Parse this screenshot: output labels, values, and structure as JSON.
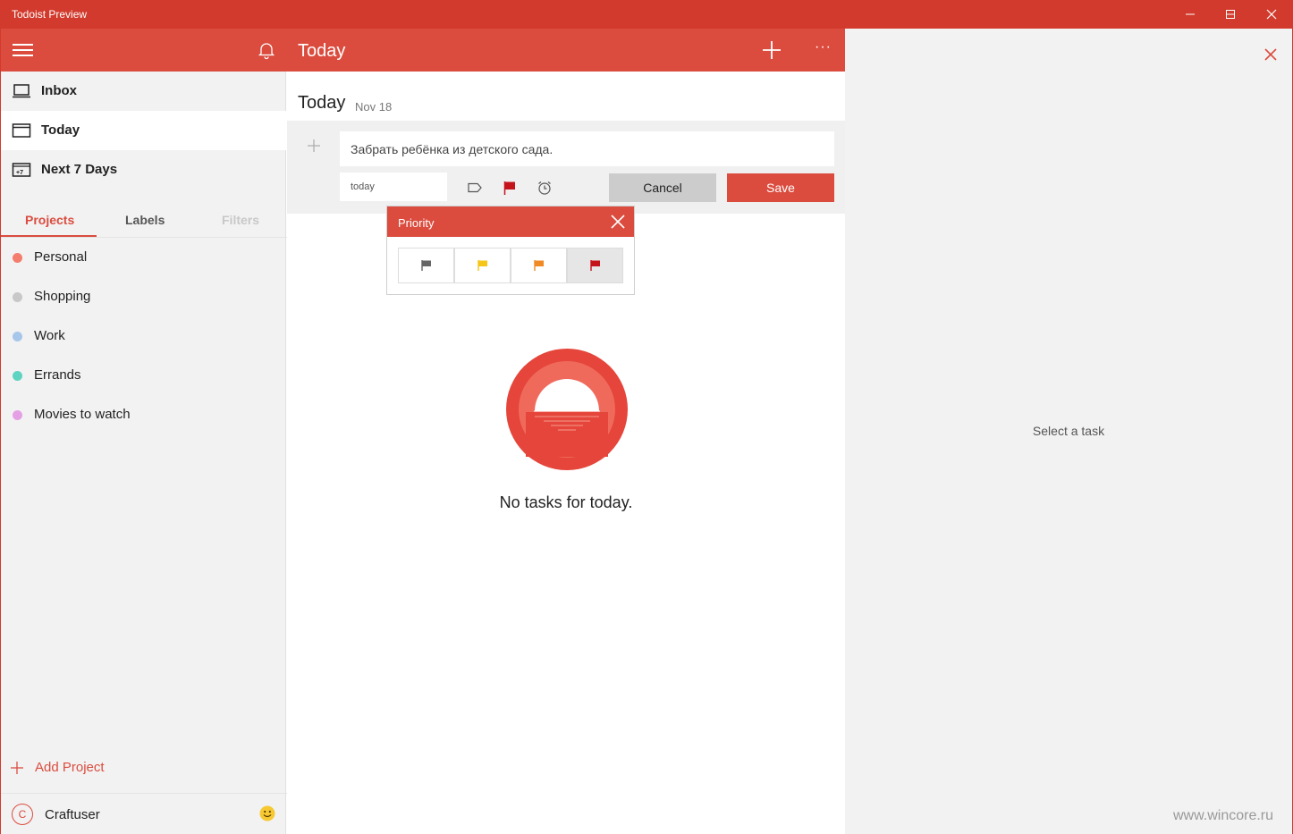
{
  "window": {
    "title": "Todoist Preview",
    "minimize_glyph": "—",
    "maximize_glyph": "☐",
    "close_glyph": "✕"
  },
  "colors": {
    "brand": "#db4c3f",
    "titlebar": "#d13a2c"
  },
  "sidebar": {
    "nav": [
      {
        "label": "Inbox",
        "icon": "inbox-icon"
      },
      {
        "label": "Today",
        "icon": "calendar-icon",
        "active": true
      },
      {
        "label": "Next 7 Days",
        "icon": "calendar-plus7-icon",
        "badge": "+7"
      }
    ],
    "tabs": [
      {
        "label": "Projects",
        "active": true
      },
      {
        "label": "Labels"
      },
      {
        "label": "Filters",
        "disabled": true
      }
    ],
    "projects": [
      {
        "label": "Personal",
        "color": "#f47e6e"
      },
      {
        "label": "Shopping",
        "color": "#c8c8c8"
      },
      {
        "label": "Work",
        "color": "#a6c6ea"
      },
      {
        "label": "Errands",
        "color": "#5fd3c1"
      },
      {
        "label": "Movies to watch",
        "color": "#e5a0e5"
      }
    ],
    "add_project": "Add Project",
    "user": {
      "initial": "C",
      "name": "Craftuser"
    }
  },
  "main": {
    "header_title": "Today",
    "more_glyph": "···",
    "day_title": "Today",
    "day_date": "Nov 18",
    "editor": {
      "task_text": "Забрать ребёнка из детского сада.",
      "date_value": "today",
      "cancel_label": "Cancel",
      "save_label": "Save"
    },
    "priority": {
      "title": "Priority",
      "flags": [
        {
          "color": "#666666"
        },
        {
          "color": "#f5c518"
        },
        {
          "color": "#f08a24"
        },
        {
          "color": "#c4131b",
          "selected": true
        }
      ]
    },
    "empty_text": "No tasks for today."
  },
  "detail": {
    "placeholder": "Select a task",
    "watermark": "www.wincore.ru"
  }
}
